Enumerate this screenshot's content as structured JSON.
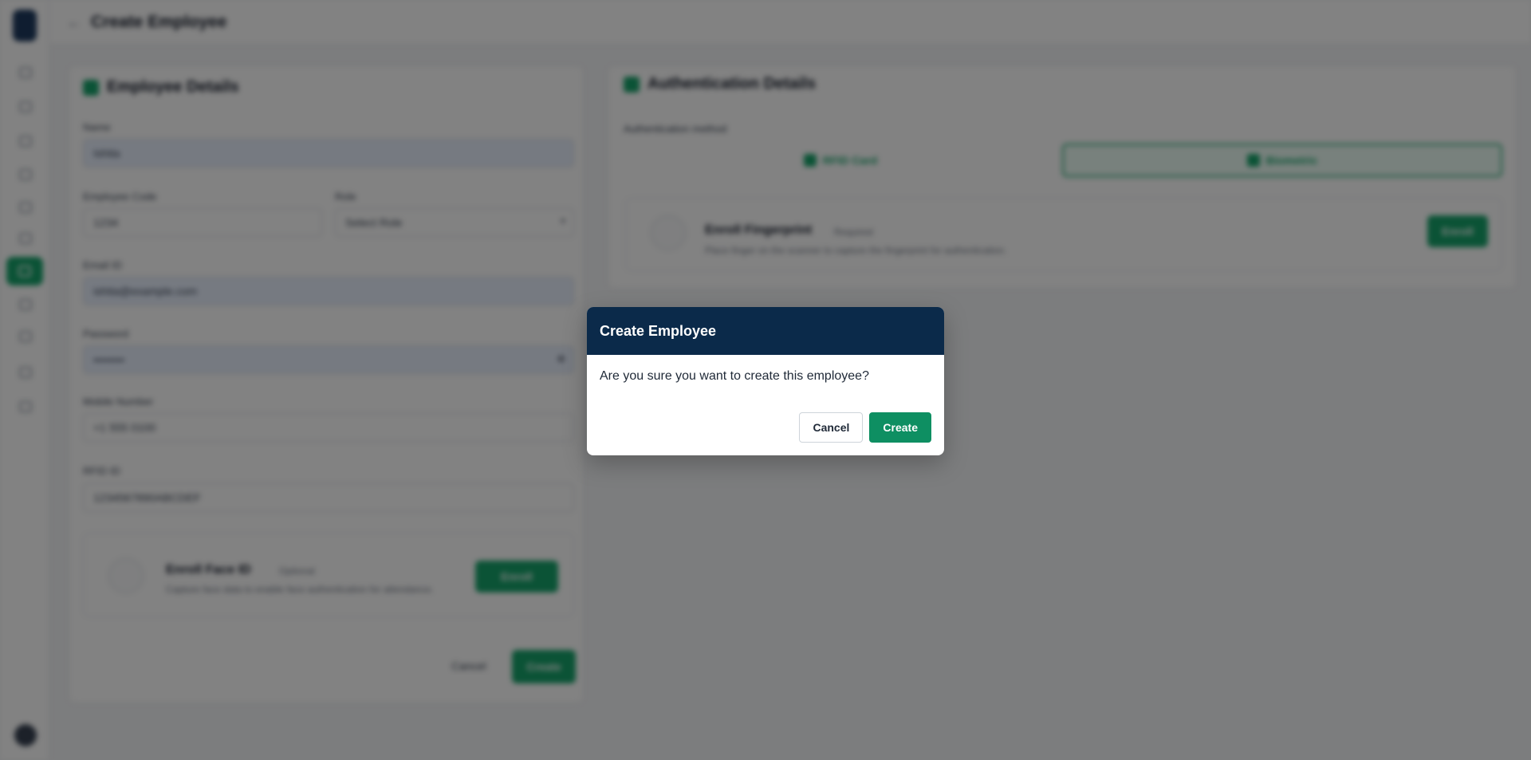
{
  "background": {
    "page_title": "Create Employee",
    "employee_section": {
      "title": "Employee Details",
      "fields": [
        {
          "label": "Name",
          "value": "Ishita"
        },
        {
          "label": "Employee Code",
          "value": "1234"
        },
        {
          "label": "Role",
          "value": "Select Role"
        },
        {
          "label": "Email ID",
          "value": "ishita@example.com"
        },
        {
          "label": "Password",
          "value": "••••••••"
        },
        {
          "label": "Mobile Number",
          "value": "+1 555 0100"
        },
        {
          "label": "RFID ID",
          "value": "1234567890ABCDEF"
        }
      ],
      "enroll": {
        "title": "Enroll Face ID",
        "badge": "Optional",
        "description": "Capture face data to enable face authentication for attendance.",
        "button": "Enroll"
      },
      "cancel_label": "Cancel",
      "create_label": "Create"
    },
    "auth_section": {
      "title": "Authentication Details",
      "method_label": "Authentication method",
      "tabs": [
        "RFID Card",
        "Biometric"
      ],
      "enroll": {
        "title": "Enroll Fingerprint",
        "badge": "Required",
        "description": "Place finger on the scanner to capture the fingerprint for authentication.",
        "button": "Enroll"
      }
    }
  },
  "modal": {
    "title": "Create Employee",
    "message": "Are you sure you want to create this employee?",
    "cancel_label": "Cancel",
    "create_label": "Create"
  },
  "colors": {
    "modal_header": "#0b2a4a",
    "primary_green": "#0e8f62",
    "overlay": "rgba(0,0,0,0.49)"
  }
}
